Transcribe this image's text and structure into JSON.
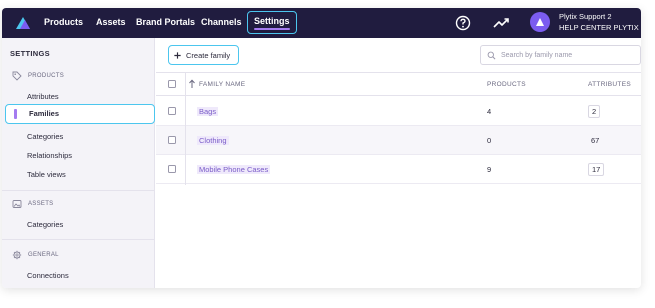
{
  "topbar": {
    "nav": [
      "Products",
      "Assets",
      "Brand Portals",
      "Channels",
      "Settings"
    ],
    "active_nav": "Settings",
    "help_icon": "help-circle-icon",
    "activity_icon": "activity-icon",
    "user_name": "Plytix Support 2",
    "user_org": "HELP CENTER PLYTIX"
  },
  "sidebar": {
    "title": "SETTINGS",
    "sections": [
      {
        "label": "PRODUCTS",
        "icon": "tag-icon",
        "items": [
          "Attributes",
          "Families",
          "Categories",
          "Relationships",
          "Table views"
        ]
      },
      {
        "label": "ASSETS",
        "icon": "image-icon",
        "items": [
          "Categories"
        ]
      },
      {
        "label": "GENERAL",
        "icon": "gear-icon",
        "items": [
          "Connections"
        ]
      }
    ],
    "active_item": "Families"
  },
  "main": {
    "create_button": "Create family",
    "search_placeholder": "Search by family name",
    "columns": [
      "FAMILY NAME",
      "PRODUCTS",
      "ATTRIBUTES"
    ],
    "rows": [
      {
        "name": "Bags",
        "products": "4",
        "attributes": "2"
      },
      {
        "name": "Clothing",
        "products": "0",
        "attributes": "67"
      },
      {
        "name": "Mobile Phone Cases",
        "products": "9",
        "attributes": "17"
      }
    ]
  },
  "colors": {
    "topbar_bg": "#201c3f",
    "highlight_border": "#4cc6ee",
    "accent_purple": "#a47bf0",
    "link_purple": "#7a5cc8"
  }
}
